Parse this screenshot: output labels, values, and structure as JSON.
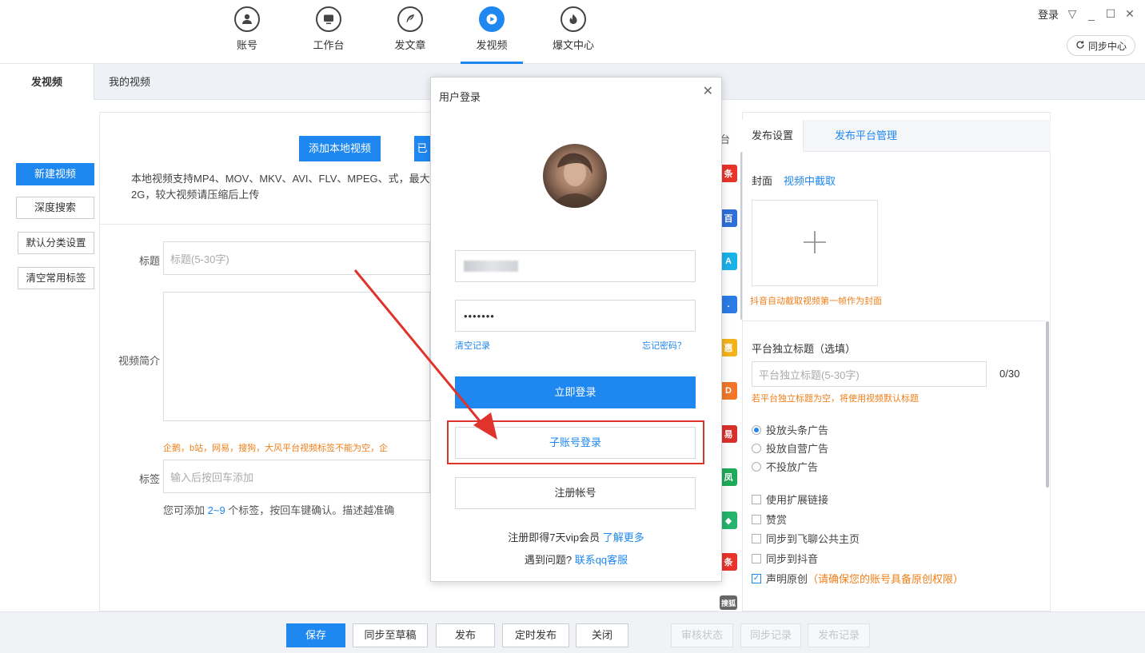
{
  "nav": {
    "items": [
      {
        "label": "账号",
        "icon": "user-icon"
      },
      {
        "label": "工作台",
        "icon": "monitor-icon"
      },
      {
        "label": "发文章",
        "icon": "feather-icon"
      },
      {
        "label": "发视频",
        "icon": "play-icon"
      },
      {
        "label": "爆文中心",
        "icon": "fire-icon"
      }
    ],
    "active_index": 3
  },
  "topright": {
    "login": "登录",
    "sync_center": "同步中心"
  },
  "tabs": {
    "publish_video": "发视频",
    "my_videos": "我的视频"
  },
  "sidebar": {
    "new_video": "新建视频",
    "deep_search": "深度搜索",
    "default_category": "默认分类设置",
    "clear_tags": "清空常用标签"
  },
  "form": {
    "add_local_video": "添加本地视频",
    "second_button_fragment": "已",
    "support_text": "本地视频支持MP4、MOV、MKV、AVI、FLV、MPEG、式，最大2G，较大视频请压缩后上传",
    "title_label": "标题",
    "title_placeholder": "标题(5-30字)",
    "intro_label": "视频简介",
    "tag_warning": "企鹅，b站，网易，搜狗，大风平台视频标签不能为空，企",
    "tag_label": "标签",
    "tag_placeholder": "输入后按回车添加",
    "tag_hint_pre": "您可添加 ",
    "tag_hint_range": "2~9",
    "tag_hint_post": " 个标签，按回车键确认。描述越准确"
  },
  "strip": {
    "title_fragment": "台",
    "icons": [
      {
        "glyph": "条",
        "color": "#e8332a"
      },
      {
        "glyph": "百",
        "color": "#2f6fd8"
      },
      {
        "glyph": "A",
        "color": "#1ab0e8"
      },
      {
        "glyph": ".",
        "color": "#2c7be5"
      },
      {
        "glyph": "惠",
        "color": "#f2b21b"
      },
      {
        "glyph": "D",
        "color": "#f0772a"
      },
      {
        "glyph": "易",
        "color": "#d9302c"
      },
      {
        "glyph": "凤",
        "color": "#1faa59"
      },
      {
        "glyph": "◆",
        "color": "#26b36b"
      },
      {
        "glyph": "条",
        "color": "#e8332a"
      },
      {
        "glyph": "搜狐",
        "color": "#666666"
      }
    ]
  },
  "right": {
    "tab_settings": "发布设置",
    "tab_platform": "发布平台管理",
    "cover_label": "封面",
    "cover_link": "视频中截取",
    "cover_tip": "抖音自动截取视频第一帧作为封面",
    "indep_title_label": "平台独立标题（选填）",
    "indep_title_placeholder": "平台独立标题(5-30字)",
    "indep_title_count": "0/30",
    "indep_title_tip": "若平台独立标题为空，将使用视频默认标题",
    "ad_options": [
      {
        "label": "投放头条广告",
        "checked": true
      },
      {
        "label": "投放自营广告",
        "checked": false
      },
      {
        "label": "不投放广告",
        "checked": false
      }
    ],
    "checks": [
      {
        "label": "使用扩展链接",
        "checked": false
      },
      {
        "label": "赞赏",
        "checked": false
      },
      {
        "label": "同步到飞聊公共主页",
        "checked": false
      },
      {
        "label": "同步到抖音",
        "checked": false
      }
    ],
    "original_label": "声明原创",
    "original_note": "（请确保您的账号具备原创权限）"
  },
  "bottom": {
    "save": "保存",
    "sync_draft": "同步至草稿",
    "publish": "发布",
    "scheduled": "定时发布",
    "close": "关闭",
    "review_status": "审核状态",
    "sync_record": "同步记录",
    "publish_record": "发布记录"
  },
  "modal": {
    "title": "用户登录",
    "password_mask": "•••••••",
    "clear_record": "清空记录",
    "forgot_password": "忘记密码？",
    "login_now": "立即登录",
    "sub_account_login": "子账号登录",
    "register": "注册帐号",
    "promo_pre": "注册即得7天vip会员 ",
    "promo_link": "了解更多",
    "help_pre": "遇到问题? ",
    "help_link": "联系qq客服"
  },
  "colors": {
    "accent": "#1e87f0",
    "warning": "#f07f1a",
    "highlight": "#e0332b"
  }
}
